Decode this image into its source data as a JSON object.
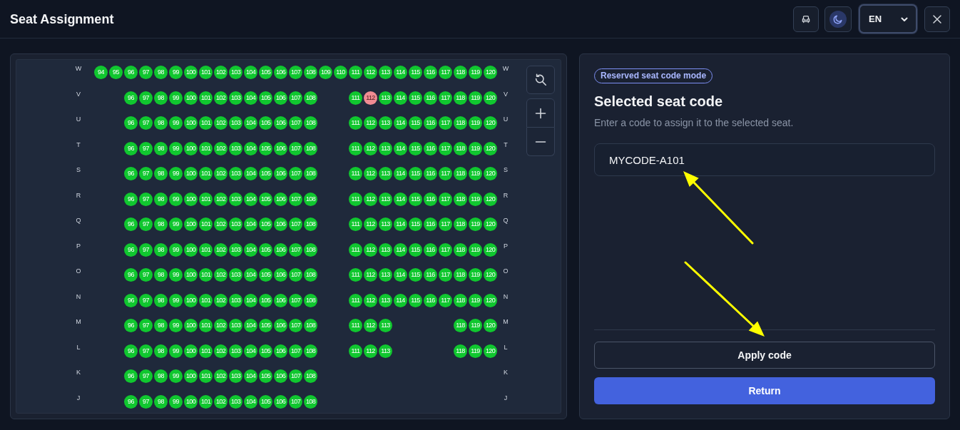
{
  "header": {
    "title": "Seat Assignment",
    "theme_toggle": {
      "on": true
    },
    "language_select": {
      "value": "EN",
      "focused": true
    }
  },
  "seat_map": {
    "rows": [
      {
        "label_left": "W",
        "label_right": "W",
        "seats": [
          {
            "kind": "seat",
            "number": "94",
            "selected": false
          },
          {
            "kind": "seat",
            "number": "95",
            "selected": false
          },
          {
            "kind": "seat",
            "number": "96",
            "selected": false
          },
          {
            "kind": "seat",
            "number": "97",
            "selected": false
          },
          {
            "kind": "seat",
            "number": "98",
            "selected": false
          },
          {
            "kind": "seat",
            "number": "99",
            "selected": false
          },
          {
            "kind": "seat",
            "number": "100",
            "selected": false
          },
          {
            "kind": "seat",
            "number": "101",
            "selected": false
          },
          {
            "kind": "seat",
            "number": "102",
            "selected": false
          },
          {
            "kind": "seat",
            "number": "103",
            "selected": false
          },
          {
            "kind": "seat",
            "number": "104",
            "selected": false
          },
          {
            "kind": "seat",
            "number": "105",
            "selected": false
          },
          {
            "kind": "seat",
            "number": "106",
            "selected": false
          },
          {
            "kind": "seat",
            "number": "107",
            "selected": false
          },
          {
            "kind": "seat",
            "number": "108",
            "selected": false
          },
          {
            "kind": "seat",
            "number": "109",
            "selected": false
          },
          {
            "kind": "seat",
            "number": "110",
            "selected": false
          },
          {
            "kind": "seat",
            "number": "111",
            "selected": false
          },
          {
            "kind": "seat",
            "number": "112",
            "selected": false
          },
          {
            "kind": "seat",
            "number": "113",
            "selected": false
          },
          {
            "kind": "seat",
            "number": "114",
            "selected": false
          },
          {
            "kind": "seat",
            "number": "115",
            "selected": false
          },
          {
            "kind": "seat",
            "number": "116",
            "selected": false
          },
          {
            "kind": "seat",
            "number": "117",
            "selected": false
          },
          {
            "kind": "seat",
            "number": "118",
            "selected": false
          },
          {
            "kind": "seat",
            "number": "119",
            "selected": false
          },
          {
            "kind": "seat",
            "number": "120",
            "selected": false
          }
        ]
      },
      {
        "label_left": "V",
        "label_right": "V",
        "seats": [
          {
            "kind": "gap"
          },
          {
            "kind": "gap"
          },
          {
            "kind": "seat",
            "number": "96",
            "selected": false
          },
          {
            "kind": "seat",
            "number": "97",
            "selected": false
          },
          {
            "kind": "seat",
            "number": "98",
            "selected": false
          },
          {
            "kind": "seat",
            "number": "99",
            "selected": false
          },
          {
            "kind": "seat",
            "number": "100",
            "selected": false
          },
          {
            "kind": "seat",
            "number": "101",
            "selected": false
          },
          {
            "kind": "seat",
            "number": "102",
            "selected": false
          },
          {
            "kind": "seat",
            "number": "103",
            "selected": false
          },
          {
            "kind": "seat",
            "number": "104",
            "selected": false
          },
          {
            "kind": "seat",
            "number": "105",
            "selected": false
          },
          {
            "kind": "seat",
            "number": "106",
            "selected": false
          },
          {
            "kind": "seat",
            "number": "107",
            "selected": false
          },
          {
            "kind": "seat",
            "number": "108",
            "selected": false
          },
          {
            "kind": "gap"
          },
          {
            "kind": "gap"
          },
          {
            "kind": "seat",
            "number": "111",
            "selected": false
          },
          {
            "kind": "seat",
            "number": "112",
            "selected": true
          },
          {
            "kind": "seat",
            "number": "113",
            "selected": false
          },
          {
            "kind": "seat",
            "number": "114",
            "selected": false
          },
          {
            "kind": "seat",
            "number": "115",
            "selected": false
          },
          {
            "kind": "seat",
            "number": "116",
            "selected": false
          },
          {
            "kind": "seat",
            "number": "117",
            "selected": false
          },
          {
            "kind": "seat",
            "number": "118",
            "selected": false
          },
          {
            "kind": "seat",
            "number": "119",
            "selected": false
          },
          {
            "kind": "seat",
            "number": "120",
            "selected": false
          }
        ]
      },
      {
        "label_left": "U",
        "label_right": "U",
        "seats": [
          {
            "kind": "gap"
          },
          {
            "kind": "gap"
          },
          {
            "kind": "seat",
            "number": "96",
            "selected": false
          },
          {
            "kind": "seat",
            "number": "97",
            "selected": false
          },
          {
            "kind": "seat",
            "number": "98",
            "selected": false
          },
          {
            "kind": "seat",
            "number": "99",
            "selected": false
          },
          {
            "kind": "seat",
            "number": "100",
            "selected": false
          },
          {
            "kind": "seat",
            "number": "101",
            "selected": false
          },
          {
            "kind": "seat",
            "number": "102",
            "selected": false
          },
          {
            "kind": "seat",
            "number": "103",
            "selected": false
          },
          {
            "kind": "seat",
            "number": "104",
            "selected": false
          },
          {
            "kind": "seat",
            "number": "105",
            "selected": false
          },
          {
            "kind": "seat",
            "number": "106",
            "selected": false
          },
          {
            "kind": "seat",
            "number": "107",
            "selected": false
          },
          {
            "kind": "seat",
            "number": "108",
            "selected": false
          },
          {
            "kind": "gap"
          },
          {
            "kind": "gap"
          },
          {
            "kind": "seat",
            "number": "111",
            "selected": false
          },
          {
            "kind": "seat",
            "number": "112",
            "selected": false
          },
          {
            "kind": "seat",
            "number": "113",
            "selected": false
          },
          {
            "kind": "seat",
            "number": "114",
            "selected": false
          },
          {
            "kind": "seat",
            "number": "115",
            "selected": false
          },
          {
            "kind": "seat",
            "number": "116",
            "selected": false
          },
          {
            "kind": "seat",
            "number": "117",
            "selected": false
          },
          {
            "kind": "seat",
            "number": "118",
            "selected": false
          },
          {
            "kind": "seat",
            "number": "119",
            "selected": false
          },
          {
            "kind": "seat",
            "number": "120",
            "selected": false
          }
        ]
      },
      {
        "label_left": "T",
        "label_right": "T",
        "seats": [
          {
            "kind": "gap"
          },
          {
            "kind": "gap"
          },
          {
            "kind": "seat",
            "number": "96",
            "selected": false
          },
          {
            "kind": "seat",
            "number": "97",
            "selected": false
          },
          {
            "kind": "seat",
            "number": "98",
            "selected": false
          },
          {
            "kind": "seat",
            "number": "99",
            "selected": false
          },
          {
            "kind": "seat",
            "number": "100",
            "selected": false
          },
          {
            "kind": "seat",
            "number": "101",
            "selected": false
          },
          {
            "kind": "seat",
            "number": "102",
            "selected": false
          },
          {
            "kind": "seat",
            "number": "103",
            "selected": false
          },
          {
            "kind": "seat",
            "number": "104",
            "selected": false
          },
          {
            "kind": "seat",
            "number": "105",
            "selected": false
          },
          {
            "kind": "seat",
            "number": "106",
            "selected": false
          },
          {
            "kind": "seat",
            "number": "107",
            "selected": false
          },
          {
            "kind": "seat",
            "number": "108",
            "selected": false
          },
          {
            "kind": "gap"
          },
          {
            "kind": "gap"
          },
          {
            "kind": "seat",
            "number": "111",
            "selected": false
          },
          {
            "kind": "seat",
            "number": "112",
            "selected": false
          },
          {
            "kind": "seat",
            "number": "113",
            "selected": false
          },
          {
            "kind": "seat",
            "number": "114",
            "selected": false
          },
          {
            "kind": "seat",
            "number": "115",
            "selected": false
          },
          {
            "kind": "seat",
            "number": "116",
            "selected": false
          },
          {
            "kind": "seat",
            "number": "117",
            "selected": false
          },
          {
            "kind": "seat",
            "number": "118",
            "selected": false
          },
          {
            "kind": "seat",
            "number": "119",
            "selected": false
          },
          {
            "kind": "seat",
            "number": "120",
            "selected": false
          }
        ]
      },
      {
        "label_left": "S",
        "label_right": "S",
        "seats": [
          {
            "kind": "gap"
          },
          {
            "kind": "gap"
          },
          {
            "kind": "seat",
            "number": "96",
            "selected": false
          },
          {
            "kind": "seat",
            "number": "97",
            "selected": false
          },
          {
            "kind": "seat",
            "number": "98",
            "selected": false
          },
          {
            "kind": "seat",
            "number": "99",
            "selected": false
          },
          {
            "kind": "seat",
            "number": "100",
            "selected": false
          },
          {
            "kind": "seat",
            "number": "101",
            "selected": false
          },
          {
            "kind": "seat",
            "number": "102",
            "selected": false
          },
          {
            "kind": "seat",
            "number": "103",
            "selected": false
          },
          {
            "kind": "seat",
            "number": "104",
            "selected": false
          },
          {
            "kind": "seat",
            "number": "105",
            "selected": false
          },
          {
            "kind": "seat",
            "number": "106",
            "selected": false
          },
          {
            "kind": "seat",
            "number": "107",
            "selected": false
          },
          {
            "kind": "seat",
            "number": "108",
            "selected": false
          },
          {
            "kind": "gap"
          },
          {
            "kind": "gap"
          },
          {
            "kind": "seat",
            "number": "111",
            "selected": false
          },
          {
            "kind": "seat",
            "number": "112",
            "selected": false
          },
          {
            "kind": "seat",
            "number": "113",
            "selected": false
          },
          {
            "kind": "seat",
            "number": "114",
            "selected": false
          },
          {
            "kind": "seat",
            "number": "115",
            "selected": false
          },
          {
            "kind": "seat",
            "number": "116",
            "selected": false
          },
          {
            "kind": "seat",
            "number": "117",
            "selected": false
          },
          {
            "kind": "seat",
            "number": "118",
            "selected": false
          },
          {
            "kind": "seat",
            "number": "119",
            "selected": false
          },
          {
            "kind": "seat",
            "number": "120",
            "selected": false
          }
        ]
      },
      {
        "label_left": "R",
        "label_right": "R",
        "seats": [
          {
            "kind": "gap"
          },
          {
            "kind": "gap"
          },
          {
            "kind": "seat",
            "number": "96",
            "selected": false
          },
          {
            "kind": "seat",
            "number": "97",
            "selected": false
          },
          {
            "kind": "seat",
            "number": "98",
            "selected": false
          },
          {
            "kind": "seat",
            "number": "99",
            "selected": false
          },
          {
            "kind": "seat",
            "number": "100",
            "selected": false
          },
          {
            "kind": "seat",
            "number": "101",
            "selected": false
          },
          {
            "kind": "seat",
            "number": "102",
            "selected": false
          },
          {
            "kind": "seat",
            "number": "103",
            "selected": false
          },
          {
            "kind": "seat",
            "number": "104",
            "selected": false
          },
          {
            "kind": "seat",
            "number": "105",
            "selected": false
          },
          {
            "kind": "seat",
            "number": "106",
            "selected": false
          },
          {
            "kind": "seat",
            "number": "107",
            "selected": false
          },
          {
            "kind": "seat",
            "number": "108",
            "selected": false
          },
          {
            "kind": "gap"
          },
          {
            "kind": "gap"
          },
          {
            "kind": "seat",
            "number": "111",
            "selected": false
          },
          {
            "kind": "seat",
            "number": "112",
            "selected": false
          },
          {
            "kind": "seat",
            "number": "113",
            "selected": false
          },
          {
            "kind": "seat",
            "number": "114",
            "selected": false
          },
          {
            "kind": "seat",
            "number": "115",
            "selected": false
          },
          {
            "kind": "seat",
            "number": "116",
            "selected": false
          },
          {
            "kind": "seat",
            "number": "117",
            "selected": false
          },
          {
            "kind": "seat",
            "number": "118",
            "selected": false
          },
          {
            "kind": "seat",
            "number": "119",
            "selected": false
          },
          {
            "kind": "seat",
            "number": "120",
            "selected": false
          }
        ]
      },
      {
        "label_left": "Q",
        "label_right": "Q",
        "seats": [
          {
            "kind": "gap"
          },
          {
            "kind": "gap"
          },
          {
            "kind": "seat",
            "number": "96",
            "selected": false
          },
          {
            "kind": "seat",
            "number": "97",
            "selected": false
          },
          {
            "kind": "seat",
            "number": "98",
            "selected": false
          },
          {
            "kind": "seat",
            "number": "99",
            "selected": false
          },
          {
            "kind": "seat",
            "number": "100",
            "selected": false
          },
          {
            "kind": "seat",
            "number": "101",
            "selected": false
          },
          {
            "kind": "seat",
            "number": "102",
            "selected": false
          },
          {
            "kind": "seat",
            "number": "103",
            "selected": false
          },
          {
            "kind": "seat",
            "number": "104",
            "selected": false
          },
          {
            "kind": "seat",
            "number": "105",
            "selected": false
          },
          {
            "kind": "seat",
            "number": "106",
            "selected": false
          },
          {
            "kind": "seat",
            "number": "107",
            "selected": false
          },
          {
            "kind": "seat",
            "number": "108",
            "selected": false
          },
          {
            "kind": "gap"
          },
          {
            "kind": "gap"
          },
          {
            "kind": "seat",
            "number": "111",
            "selected": false
          },
          {
            "kind": "seat",
            "number": "112",
            "selected": false
          },
          {
            "kind": "seat",
            "number": "113",
            "selected": false
          },
          {
            "kind": "seat",
            "number": "114",
            "selected": false
          },
          {
            "kind": "seat",
            "number": "115",
            "selected": false
          },
          {
            "kind": "seat",
            "number": "116",
            "selected": false
          },
          {
            "kind": "seat",
            "number": "117",
            "selected": false
          },
          {
            "kind": "seat",
            "number": "118",
            "selected": false
          },
          {
            "kind": "seat",
            "number": "119",
            "selected": false
          },
          {
            "kind": "seat",
            "number": "120",
            "selected": false
          }
        ]
      },
      {
        "label_left": "P",
        "label_right": "P",
        "seats": [
          {
            "kind": "gap"
          },
          {
            "kind": "gap"
          },
          {
            "kind": "seat",
            "number": "96",
            "selected": false
          },
          {
            "kind": "seat",
            "number": "97",
            "selected": false
          },
          {
            "kind": "seat",
            "number": "98",
            "selected": false
          },
          {
            "kind": "seat",
            "number": "99",
            "selected": false
          },
          {
            "kind": "seat",
            "number": "100",
            "selected": false
          },
          {
            "kind": "seat",
            "number": "101",
            "selected": false
          },
          {
            "kind": "seat",
            "number": "102",
            "selected": false
          },
          {
            "kind": "seat",
            "number": "103",
            "selected": false
          },
          {
            "kind": "seat",
            "number": "104",
            "selected": false
          },
          {
            "kind": "seat",
            "number": "105",
            "selected": false
          },
          {
            "kind": "seat",
            "number": "106",
            "selected": false
          },
          {
            "kind": "seat",
            "number": "107",
            "selected": false
          },
          {
            "kind": "seat",
            "number": "108",
            "selected": false
          },
          {
            "kind": "gap"
          },
          {
            "kind": "gap"
          },
          {
            "kind": "seat",
            "number": "111",
            "selected": false
          },
          {
            "kind": "seat",
            "number": "112",
            "selected": false
          },
          {
            "kind": "seat",
            "number": "113",
            "selected": false
          },
          {
            "kind": "seat",
            "number": "114",
            "selected": false
          },
          {
            "kind": "seat",
            "number": "115",
            "selected": false
          },
          {
            "kind": "seat",
            "number": "116",
            "selected": false
          },
          {
            "kind": "seat",
            "number": "117",
            "selected": false
          },
          {
            "kind": "seat",
            "number": "118",
            "selected": false
          },
          {
            "kind": "seat",
            "number": "119",
            "selected": false
          },
          {
            "kind": "seat",
            "number": "120",
            "selected": false
          }
        ]
      },
      {
        "label_left": "O",
        "label_right": "O",
        "seats": [
          {
            "kind": "gap"
          },
          {
            "kind": "gap"
          },
          {
            "kind": "seat",
            "number": "96",
            "selected": false
          },
          {
            "kind": "seat",
            "number": "97",
            "selected": false
          },
          {
            "kind": "seat",
            "number": "98",
            "selected": false
          },
          {
            "kind": "seat",
            "number": "99",
            "selected": false
          },
          {
            "kind": "seat",
            "number": "100",
            "selected": false
          },
          {
            "kind": "seat",
            "number": "101",
            "selected": false
          },
          {
            "kind": "seat",
            "number": "102",
            "selected": false
          },
          {
            "kind": "seat",
            "number": "103",
            "selected": false
          },
          {
            "kind": "seat",
            "number": "104",
            "selected": false
          },
          {
            "kind": "seat",
            "number": "105",
            "selected": false
          },
          {
            "kind": "seat",
            "number": "106",
            "selected": false
          },
          {
            "kind": "seat",
            "number": "107",
            "selected": false
          },
          {
            "kind": "seat",
            "number": "108",
            "selected": false
          },
          {
            "kind": "gap"
          },
          {
            "kind": "gap"
          },
          {
            "kind": "seat",
            "number": "111",
            "selected": false
          },
          {
            "kind": "seat",
            "number": "112",
            "selected": false
          },
          {
            "kind": "seat",
            "number": "113",
            "selected": false
          },
          {
            "kind": "seat",
            "number": "114",
            "selected": false
          },
          {
            "kind": "seat",
            "number": "115",
            "selected": false
          },
          {
            "kind": "seat",
            "number": "116",
            "selected": false
          },
          {
            "kind": "seat",
            "number": "117",
            "selected": false
          },
          {
            "kind": "seat",
            "number": "118",
            "selected": false
          },
          {
            "kind": "seat",
            "number": "119",
            "selected": false
          },
          {
            "kind": "seat",
            "number": "120",
            "selected": false
          }
        ]
      },
      {
        "label_left": "N",
        "label_right": "N",
        "seats": [
          {
            "kind": "gap"
          },
          {
            "kind": "gap"
          },
          {
            "kind": "seat",
            "number": "96",
            "selected": false
          },
          {
            "kind": "seat",
            "number": "97",
            "selected": false
          },
          {
            "kind": "seat",
            "number": "98",
            "selected": false
          },
          {
            "kind": "seat",
            "number": "99",
            "selected": false
          },
          {
            "kind": "seat",
            "number": "100",
            "selected": false
          },
          {
            "kind": "seat",
            "number": "101",
            "selected": false
          },
          {
            "kind": "seat",
            "number": "102",
            "selected": false
          },
          {
            "kind": "seat",
            "number": "103",
            "selected": false
          },
          {
            "kind": "seat",
            "number": "104",
            "selected": false
          },
          {
            "kind": "seat",
            "number": "105",
            "selected": false
          },
          {
            "kind": "seat",
            "number": "106",
            "selected": false
          },
          {
            "kind": "seat",
            "number": "107",
            "selected": false
          },
          {
            "kind": "seat",
            "number": "108",
            "selected": false
          },
          {
            "kind": "gap"
          },
          {
            "kind": "gap"
          },
          {
            "kind": "seat",
            "number": "111",
            "selected": false
          },
          {
            "kind": "seat",
            "number": "112",
            "selected": false
          },
          {
            "kind": "seat",
            "number": "113",
            "selected": false
          },
          {
            "kind": "seat",
            "number": "114",
            "selected": false
          },
          {
            "kind": "seat",
            "number": "115",
            "selected": false
          },
          {
            "kind": "seat",
            "number": "116",
            "selected": false
          },
          {
            "kind": "seat",
            "number": "117",
            "selected": false
          },
          {
            "kind": "seat",
            "number": "118",
            "selected": false
          },
          {
            "kind": "seat",
            "number": "119",
            "selected": false
          },
          {
            "kind": "seat",
            "number": "120",
            "selected": false
          }
        ]
      },
      {
        "label_left": "M",
        "label_right": "M",
        "seats": [
          {
            "kind": "gap"
          },
          {
            "kind": "gap"
          },
          {
            "kind": "seat",
            "number": "96",
            "selected": false
          },
          {
            "kind": "seat",
            "number": "97",
            "selected": false
          },
          {
            "kind": "seat",
            "number": "98",
            "selected": false
          },
          {
            "kind": "seat",
            "number": "99",
            "selected": false
          },
          {
            "kind": "seat",
            "number": "100",
            "selected": false
          },
          {
            "kind": "seat",
            "number": "101",
            "selected": false
          },
          {
            "kind": "seat",
            "number": "102",
            "selected": false
          },
          {
            "kind": "seat",
            "number": "103",
            "selected": false
          },
          {
            "kind": "seat",
            "number": "104",
            "selected": false
          },
          {
            "kind": "seat",
            "number": "105",
            "selected": false
          },
          {
            "kind": "seat",
            "number": "106",
            "selected": false
          },
          {
            "kind": "seat",
            "number": "107",
            "selected": false
          },
          {
            "kind": "seat",
            "number": "108",
            "selected": false
          },
          {
            "kind": "gap"
          },
          {
            "kind": "gap"
          },
          {
            "kind": "seat",
            "number": "111",
            "selected": false
          },
          {
            "kind": "seat",
            "number": "112",
            "selected": false
          },
          {
            "kind": "seat",
            "number": "113",
            "selected": false
          },
          {
            "kind": "gap"
          },
          {
            "kind": "gap"
          },
          {
            "kind": "gap"
          },
          {
            "kind": "gap"
          },
          {
            "kind": "seat",
            "number": "118",
            "selected": false
          },
          {
            "kind": "seat",
            "number": "119",
            "selected": false
          },
          {
            "kind": "seat",
            "number": "120",
            "selected": false
          }
        ]
      },
      {
        "label_left": "L",
        "label_right": "L",
        "seats": [
          {
            "kind": "gap"
          },
          {
            "kind": "gap"
          },
          {
            "kind": "seat",
            "number": "96",
            "selected": false
          },
          {
            "kind": "seat",
            "number": "97",
            "selected": false
          },
          {
            "kind": "seat",
            "number": "98",
            "selected": false
          },
          {
            "kind": "seat",
            "number": "99",
            "selected": false
          },
          {
            "kind": "seat",
            "number": "100",
            "selected": false
          },
          {
            "kind": "seat",
            "number": "101",
            "selected": false
          },
          {
            "kind": "seat",
            "number": "102",
            "selected": false
          },
          {
            "kind": "seat",
            "number": "103",
            "selected": false
          },
          {
            "kind": "seat",
            "number": "104",
            "selected": false
          },
          {
            "kind": "seat",
            "number": "105",
            "selected": false
          },
          {
            "kind": "seat",
            "number": "106",
            "selected": false
          },
          {
            "kind": "seat",
            "number": "107",
            "selected": false
          },
          {
            "kind": "seat",
            "number": "108",
            "selected": false
          },
          {
            "kind": "gap"
          },
          {
            "kind": "gap"
          },
          {
            "kind": "seat",
            "number": "111",
            "selected": false
          },
          {
            "kind": "seat",
            "number": "112",
            "selected": false
          },
          {
            "kind": "seat",
            "number": "113",
            "selected": false
          },
          {
            "kind": "gap"
          },
          {
            "kind": "gap"
          },
          {
            "kind": "gap"
          },
          {
            "kind": "gap"
          },
          {
            "kind": "seat",
            "number": "118",
            "selected": false
          },
          {
            "kind": "seat",
            "number": "119",
            "selected": false
          },
          {
            "kind": "seat",
            "number": "120",
            "selected": false
          }
        ]
      },
      {
        "label_left": "K",
        "label_right": "K",
        "seats": [
          {
            "kind": "gap"
          },
          {
            "kind": "gap"
          },
          {
            "kind": "seat",
            "number": "96",
            "selected": false
          },
          {
            "kind": "seat",
            "number": "97",
            "selected": false
          },
          {
            "kind": "seat",
            "number": "98",
            "selected": false
          },
          {
            "kind": "seat",
            "number": "99",
            "selected": false
          },
          {
            "kind": "seat",
            "number": "100",
            "selected": false
          },
          {
            "kind": "seat",
            "number": "101",
            "selected": false
          },
          {
            "kind": "seat",
            "number": "102",
            "selected": false
          },
          {
            "kind": "seat",
            "number": "103",
            "selected": false
          },
          {
            "kind": "seat",
            "number": "104",
            "selected": false
          },
          {
            "kind": "seat",
            "number": "105",
            "selected": false
          },
          {
            "kind": "seat",
            "number": "106",
            "selected": false
          },
          {
            "kind": "seat",
            "number": "107",
            "selected": false
          },
          {
            "kind": "seat",
            "number": "108",
            "selected": false
          }
        ]
      },
      {
        "label_left": "J",
        "label_right": "J",
        "seats": [
          {
            "kind": "gap"
          },
          {
            "kind": "gap"
          },
          {
            "kind": "seat",
            "number": "96",
            "selected": false
          },
          {
            "kind": "seat",
            "number": "97",
            "selected": false
          },
          {
            "kind": "seat",
            "number": "98",
            "selected": false
          },
          {
            "kind": "seat",
            "number": "99",
            "selected": false
          },
          {
            "kind": "seat",
            "number": "100",
            "selected": false
          },
          {
            "kind": "seat",
            "number": "101",
            "selected": false
          },
          {
            "kind": "seat",
            "number": "102",
            "selected": false
          },
          {
            "kind": "seat",
            "number": "103",
            "selected": false
          },
          {
            "kind": "seat",
            "number": "104",
            "selected": false
          },
          {
            "kind": "seat",
            "number": "105",
            "selected": false
          },
          {
            "kind": "seat",
            "number": "106",
            "selected": false
          },
          {
            "kind": "seat",
            "number": "107",
            "selected": false
          },
          {
            "kind": "seat",
            "number": "108",
            "selected": false
          }
        ]
      }
    ]
  },
  "panel": {
    "badge": "Reserved seat code mode",
    "title": "Selected seat code",
    "description": "Enter a code to assign it to the selected seat.",
    "code_field": {
      "value": "MYCODE-A101"
    },
    "buttons": [
      {
        "label": "Apply code",
        "kind": "outline"
      },
      {
        "label": "Return",
        "kind": "primary"
      }
    ]
  }
}
